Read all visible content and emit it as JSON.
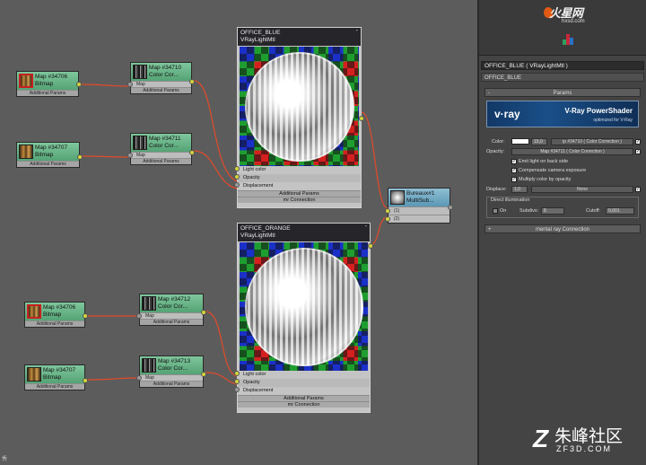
{
  "nodes": {
    "bm1": {
      "title": "Map #34706",
      "type": "Bitmap",
      "footer": "Additional Params"
    },
    "bm2": {
      "title": "Map #34707",
      "type": "Bitmap",
      "footer": "Additional Params"
    },
    "cc1": {
      "title": "Map #34710",
      "type": "Color Cor...",
      "slot": "Map",
      "footer": "Additional Params"
    },
    "cc2": {
      "title": "Map #34711",
      "type": "Color Cor...",
      "slot": "Map",
      "footer": "Additional Params"
    },
    "bm3": {
      "title": "Map #34706",
      "type": "Bitmap",
      "footer": "Additional Params"
    },
    "bm4": {
      "title": "Map #34707",
      "type": "Bitmap",
      "footer": "Additional Params"
    },
    "cc3": {
      "title": "Map #34712",
      "type": "Color Cor...",
      "slot": "Map",
      "footer": "Additional Params"
    },
    "cc4": {
      "title": "Map #34713",
      "type": "Color Cor...",
      "slot": "Map",
      "footer": "Additional Params"
    },
    "multi": {
      "title": "Bureaux#1",
      "type": "MultiSub...",
      "slot1": "(1)",
      "slot2": "(2)"
    }
  },
  "materials": {
    "blue": {
      "title": "OFFICE_BLUE",
      "type": "VRayLightMtl",
      "slots": [
        "Light color",
        "Opacity",
        "Displacement"
      ],
      "bars": [
        "Additional Params",
        "mr Connection"
      ]
    },
    "orange": {
      "title": "OFFICE_ORANGE",
      "type": "VRayLightMtl",
      "slots": [
        "Light color",
        "Opacity",
        "Displacement"
      ],
      "bars": [
        "Additional Params",
        "mr Connection"
      ]
    }
  },
  "watermark_top": {
    "logo": "火星网",
    "sub": "hxsd.com"
  },
  "panel": {
    "title": "OFFICE_BLUE  ( VRayLightMtl )",
    "name": "OFFICE_BLUE",
    "params_rollout": "Params",
    "banner": {
      "logo": "v·ray",
      "title": "V-Ray PowerShader",
      "subtitle": "optimized for V-Ray"
    },
    "color_label": "Color:",
    "color_value": "15,0",
    "color_map": "ip #34710  ( Color Correction )",
    "opacity_label": "Opacity:",
    "opacity_map": "Map #34711  ( Color Correction )",
    "emit_back": "Emit light on back side",
    "compensate": "Compensate camera exposure",
    "multiply": "Multiply color by opacity",
    "displace_label": "Displace:",
    "displace_value": "1,0",
    "displace_map": "None",
    "direct_title": "Direct illumination",
    "on_label": "On",
    "subdivs_label": "Subdivs:",
    "subdivs_value": "8",
    "cutoff_label": "Cutoff:",
    "cutoff_value": "0,001",
    "mr_rollout": "mental ray Connection",
    "plus": "+",
    "minus": "-",
    "check": "✓"
  },
  "watermark_bottom": {
    "zh": "朱峰社区",
    "en": "ZF3D.COM",
    "mark": "Z"
  },
  "corner_text": "秀"
}
